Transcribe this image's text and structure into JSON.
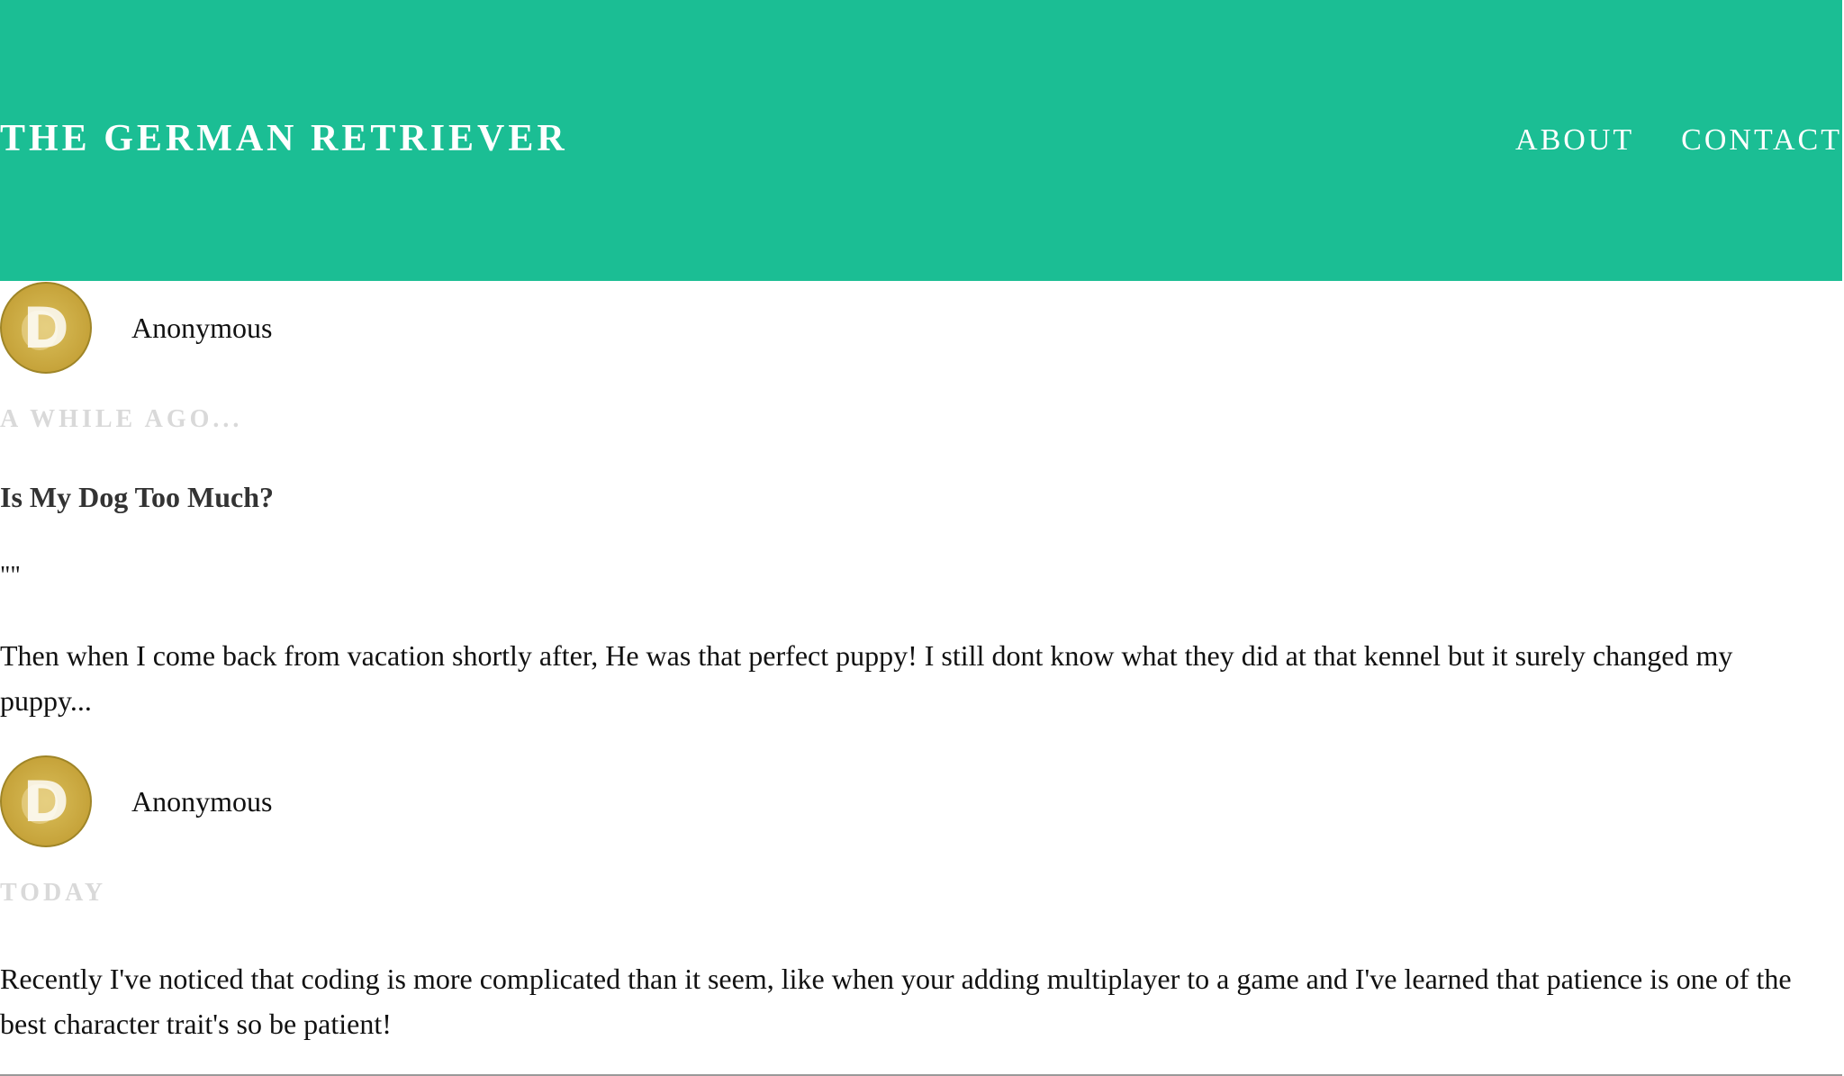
{
  "header": {
    "site_title": "THE GERMAN RETRIEVER",
    "nav": [
      {
        "label": "ABOUT"
      },
      {
        "label": "CONTACT"
      }
    ],
    "background_color": "#1bbe94"
  },
  "posts": [
    {
      "author": "Anonymous",
      "avatar_icon": "doge-coin-avatar-icon",
      "avatar_letter": "D",
      "date": "A WHILE AGO...",
      "title": "Is My Dog Too Much?",
      "quote": "\"\"",
      "body": "Then when I come back from vacation shortly after, He was that perfect puppy! I still dont know what they did at that kennel but it surely changed my puppy..."
    },
    {
      "author": "Anonymous",
      "avatar_icon": "doge-coin-avatar-icon",
      "avatar_letter": "D",
      "date": "TODAY",
      "body": "Recently I've noticed that coding is more complicated than it seem, like when your adding multiplayer to a game and I've learned that patience is one of the best character trait's so be patient!"
    }
  ]
}
